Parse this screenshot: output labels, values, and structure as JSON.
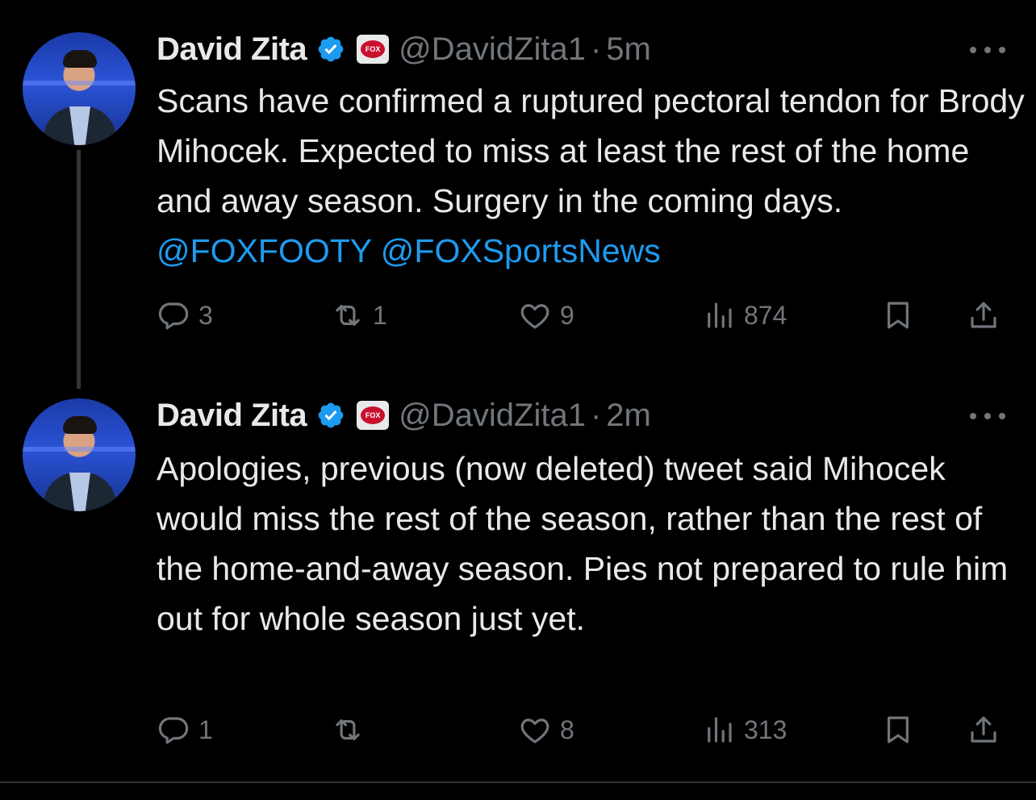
{
  "colors": {
    "background": "#000000",
    "text": "#e7e9ea",
    "muted": "#71767b",
    "link": "#1d9bf0",
    "verified": "#1d9bf0"
  },
  "tweets": [
    {
      "author": {
        "name": "David Zita",
        "handle": "@DavidZita1",
        "verified_icon": "verified-badge-icon",
        "affiliation_icon": "fox-footy-logo",
        "affiliation_text": "FOX"
      },
      "separator": "·",
      "time": "5m",
      "text": "Scans have confirmed a ruptured pectoral tendon for Brody Mihocek. Expected to miss at least the rest of the home and away season. Surgery in the coming days. ",
      "mentions": [
        "@FOXFOOTY",
        "@FOXSportsNews"
      ],
      "metrics": {
        "replies": "3",
        "retweets": "1",
        "likes": "9",
        "views": "874"
      }
    },
    {
      "author": {
        "name": "David Zita",
        "handle": "@DavidZita1",
        "verified_icon": "verified-badge-icon",
        "affiliation_icon": "fox-footy-logo",
        "affiliation_text": "FOX"
      },
      "separator": "·",
      "time": "2m",
      "text": "Apologies, previous (now deleted) tweet said Mihocek would miss the rest of the season, rather than the rest of the home-and-away season. Pies not prepared to rule him out for whole season just yet.",
      "metrics": {
        "replies": "1",
        "retweets": "",
        "likes": "8",
        "views": "313"
      }
    }
  ]
}
